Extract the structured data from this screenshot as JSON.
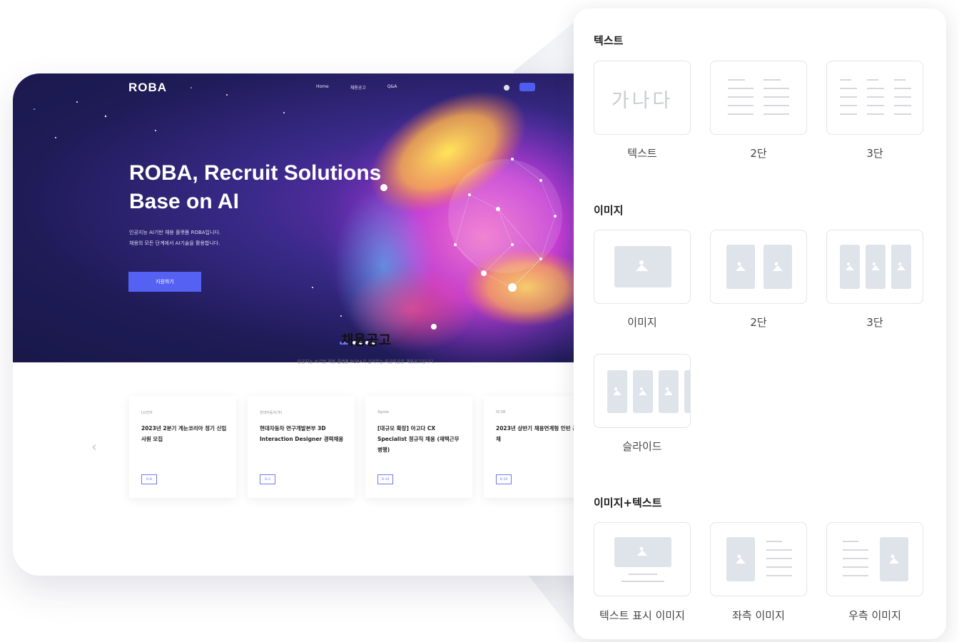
{
  "website": {
    "logo": "ROBA",
    "nav": [
      "Home",
      "채용공고",
      "Q&A"
    ],
    "hero_title": "ROBA, Recruit Solutions Base on AI",
    "hero_desc_1": "인공지능 AI기반 채용 플랫폼 ROBA입니다.",
    "hero_desc_2": "채용의 모든 단계에서 AI기술을 활용합니다.",
    "hero_cta": "지원하기",
    "jobs_title": "채용공고",
    "jobs_subtitle": "인공지능 AI기반 채용 플랫폼 ROBA가 알려주는 따끈따끈한 채용공고입니다.",
    "jobs": [
      {
        "company": "LG전자",
        "title": "2023년 2분기 게눈코리아 정기 신입사원 모집",
        "dday": "D-8"
      },
      {
        "company": "현대자동차(주)",
        "title": "현대자동차 연구개발본부 3D Interaction Designer 경력채용",
        "dday": "D-2"
      },
      {
        "company": "Agoda",
        "title": "[대규모 확장] 아고다 CX Specialist 정규직 채용 (재택근무 병행)",
        "dday": "D-10"
      },
      {
        "company": "SCSB",
        "title": "2023년 상반기 채용연계형 인턴 공채",
        "dday": "D-10"
      }
    ]
  },
  "panel": {
    "sections": {
      "text": {
        "title": "텍스트",
        "sample": "가나다",
        "tiles": [
          "텍스트",
          "2단",
          "3단"
        ]
      },
      "image": {
        "title": "이미지",
        "tiles": [
          "이미지",
          "2단",
          "3단",
          "슬라이드"
        ]
      },
      "image_text": {
        "title": "이미지+텍스트",
        "tiles": [
          "텍스트 표시 이미지",
          "좌측 이미지",
          "우측 이미지"
        ]
      }
    }
  },
  "colors": {
    "accent": "#5561f2",
    "hero_bg": "#1e1b56",
    "tile_border": "#e3e5ea",
    "placeholder": "#dfe3ea"
  }
}
